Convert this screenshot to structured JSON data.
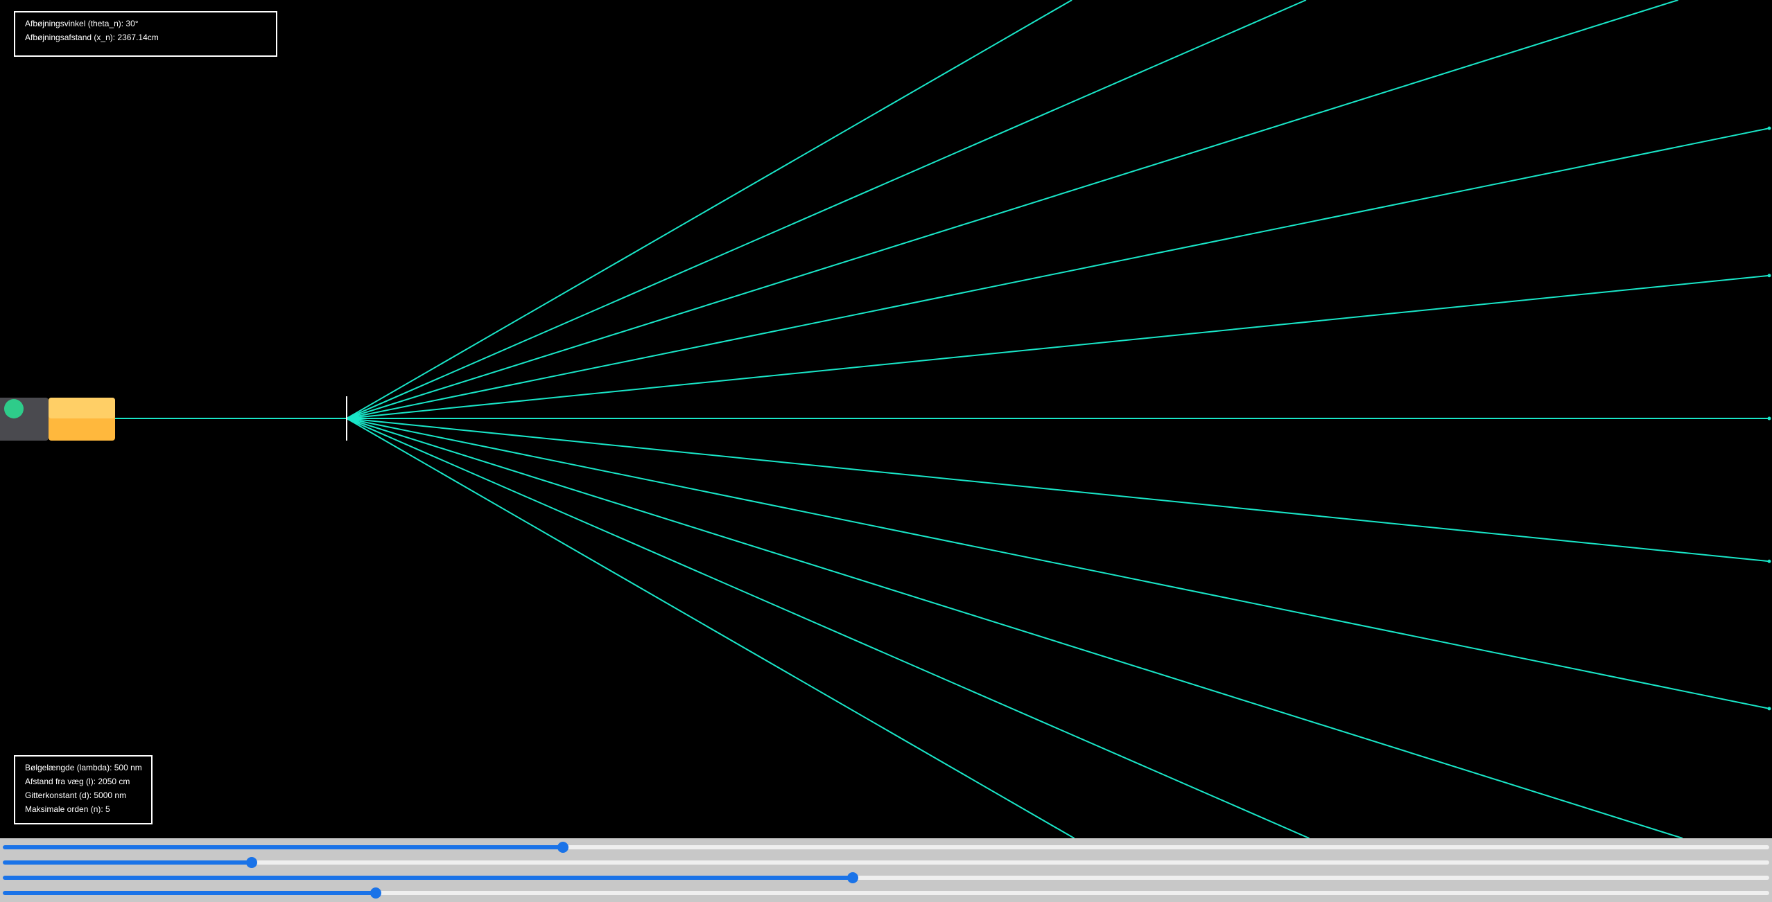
{
  "results": {
    "angle_line": "Afbøjningsvinkel (theta_n): 30°",
    "distance_line": "Afbøjningsafstand (x_n): 2367.14cm"
  },
  "parameters": {
    "wavelength_line": "Bølgelængde (lambda): 500 nm",
    "wall_distance_line": "Afstand fra væg (l): 2050 cm",
    "grating_constant_line": "Gitterkonstant (d): 5000 nm",
    "max_order_line": "Maksimale orden (n): 5"
  },
  "simulation": {
    "wavelength_nm": 500,
    "wall_distance_cm": 2050,
    "grating_constant_nm": 5000,
    "max_order": 5
  },
  "sliders": [
    {
      "name": "wavelength-slider",
      "fraction": 0.317
    },
    {
      "name": "wall-distance-slider",
      "fraction": 0.141
    },
    {
      "name": "grating-constant-slider",
      "fraction": 0.481
    },
    {
      "name": "max-order-slider",
      "fraction": 0.211
    }
  ],
  "colors": {
    "background": "#000000",
    "beam": "#19e6c8",
    "laser_body": "#ffb83d",
    "laser_body_light": "#ffcf66",
    "laser_cap": "#4a4a4f",
    "laser_indicator": "#2ecc8a",
    "grating": "#ffffff",
    "slider_accent": "#1a73e8"
  },
  "icons": {
    "laser": "laser-pointer-icon",
    "grating": "diffraction-grating-icon"
  }
}
